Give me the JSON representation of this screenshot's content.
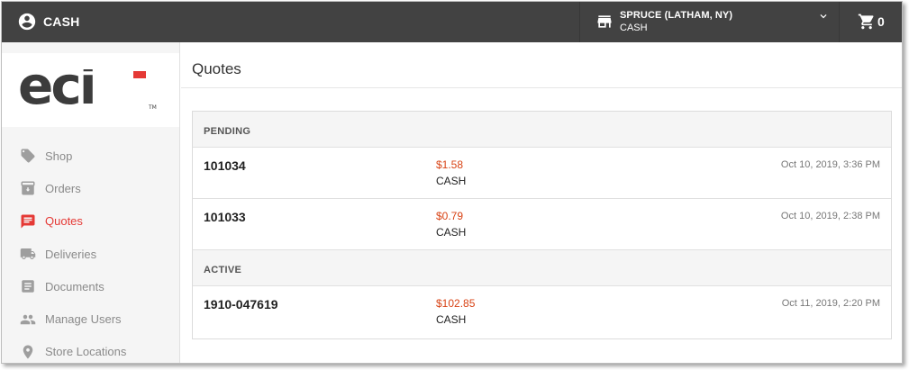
{
  "header": {
    "account_name": "CASH",
    "store": {
      "name": "SPRUCE (LATHAM, NY)",
      "account": "CASH"
    },
    "cart_count": "0"
  },
  "brand": {
    "logo_text": "eci",
    "trademark": "TM"
  },
  "sidebar": {
    "items": [
      {
        "label": "Shop",
        "icon": "tag-icon",
        "active": false
      },
      {
        "label": "Orders",
        "icon": "archive-box-icon",
        "active": false
      },
      {
        "label": "Quotes",
        "icon": "chat-bubble-icon",
        "active": true
      },
      {
        "label": "Deliveries",
        "icon": "truck-icon",
        "active": false
      },
      {
        "label": "Documents",
        "icon": "document-icon",
        "active": false
      },
      {
        "label": "Manage Users",
        "icon": "users-icon",
        "active": false
      },
      {
        "label": "Store Locations",
        "icon": "location-pin-icon",
        "active": false
      }
    ]
  },
  "main": {
    "title": "Quotes",
    "sections": [
      {
        "label": "PENDING",
        "quotes": [
          {
            "id": "101034",
            "amount": "$1.58",
            "account": "CASH",
            "date": "Oct 10, 2019, 3:36 PM"
          },
          {
            "id": "101033",
            "amount": "$0.79",
            "account": "CASH",
            "date": "Oct 10, 2019, 2:38 PM"
          }
        ]
      },
      {
        "label": "ACTIVE",
        "quotes": [
          {
            "id": "1910-047619",
            "amount": "$102.85",
            "account": "CASH",
            "date": "Oct 11, 2019, 2:20 PM"
          }
        ]
      }
    ]
  },
  "colors": {
    "topbar": "#424242",
    "accent": "#e53935",
    "amount": "#d84315",
    "nav_inactive": "#8a8a8a"
  }
}
